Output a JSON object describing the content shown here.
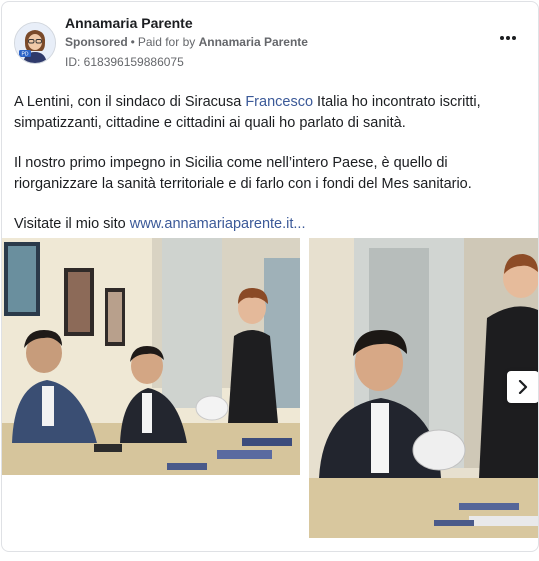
{
  "post": {
    "page_name": "Annamaria Parente",
    "sponsored_label": "Sponsored",
    "paid_for_prefix": "Paid for by",
    "advertiser": "Annamaria Parente",
    "ad_id": "ID: 618396159886075",
    "more_icon": "more-horizontal-icon",
    "body": {
      "p1_before": "A Lentini, con il sindaco di Siracusa ",
      "p1_link": "Francesco",
      "p1_after": " Italia ho incontrato iscritti, simpatizzanti, cittadine e cittadini ai quali ho parlato di sanità.",
      "p2": "Il nostro primo impegno in Sicilia come nell’intero Paese, è quello di riorganizzare la sanità territoriale e di farlo con i fondi del Mes sanitario.",
      "p3_before": "Visitate il mio sito ",
      "p3_link": "www.annamariaparente.it...",
      "link_color": "#3b5998"
    },
    "gallery": {
      "next_icon": "chevron-right-icon",
      "photos": [
        "meeting-photo-1",
        "meeting-photo-2"
      ]
    }
  }
}
